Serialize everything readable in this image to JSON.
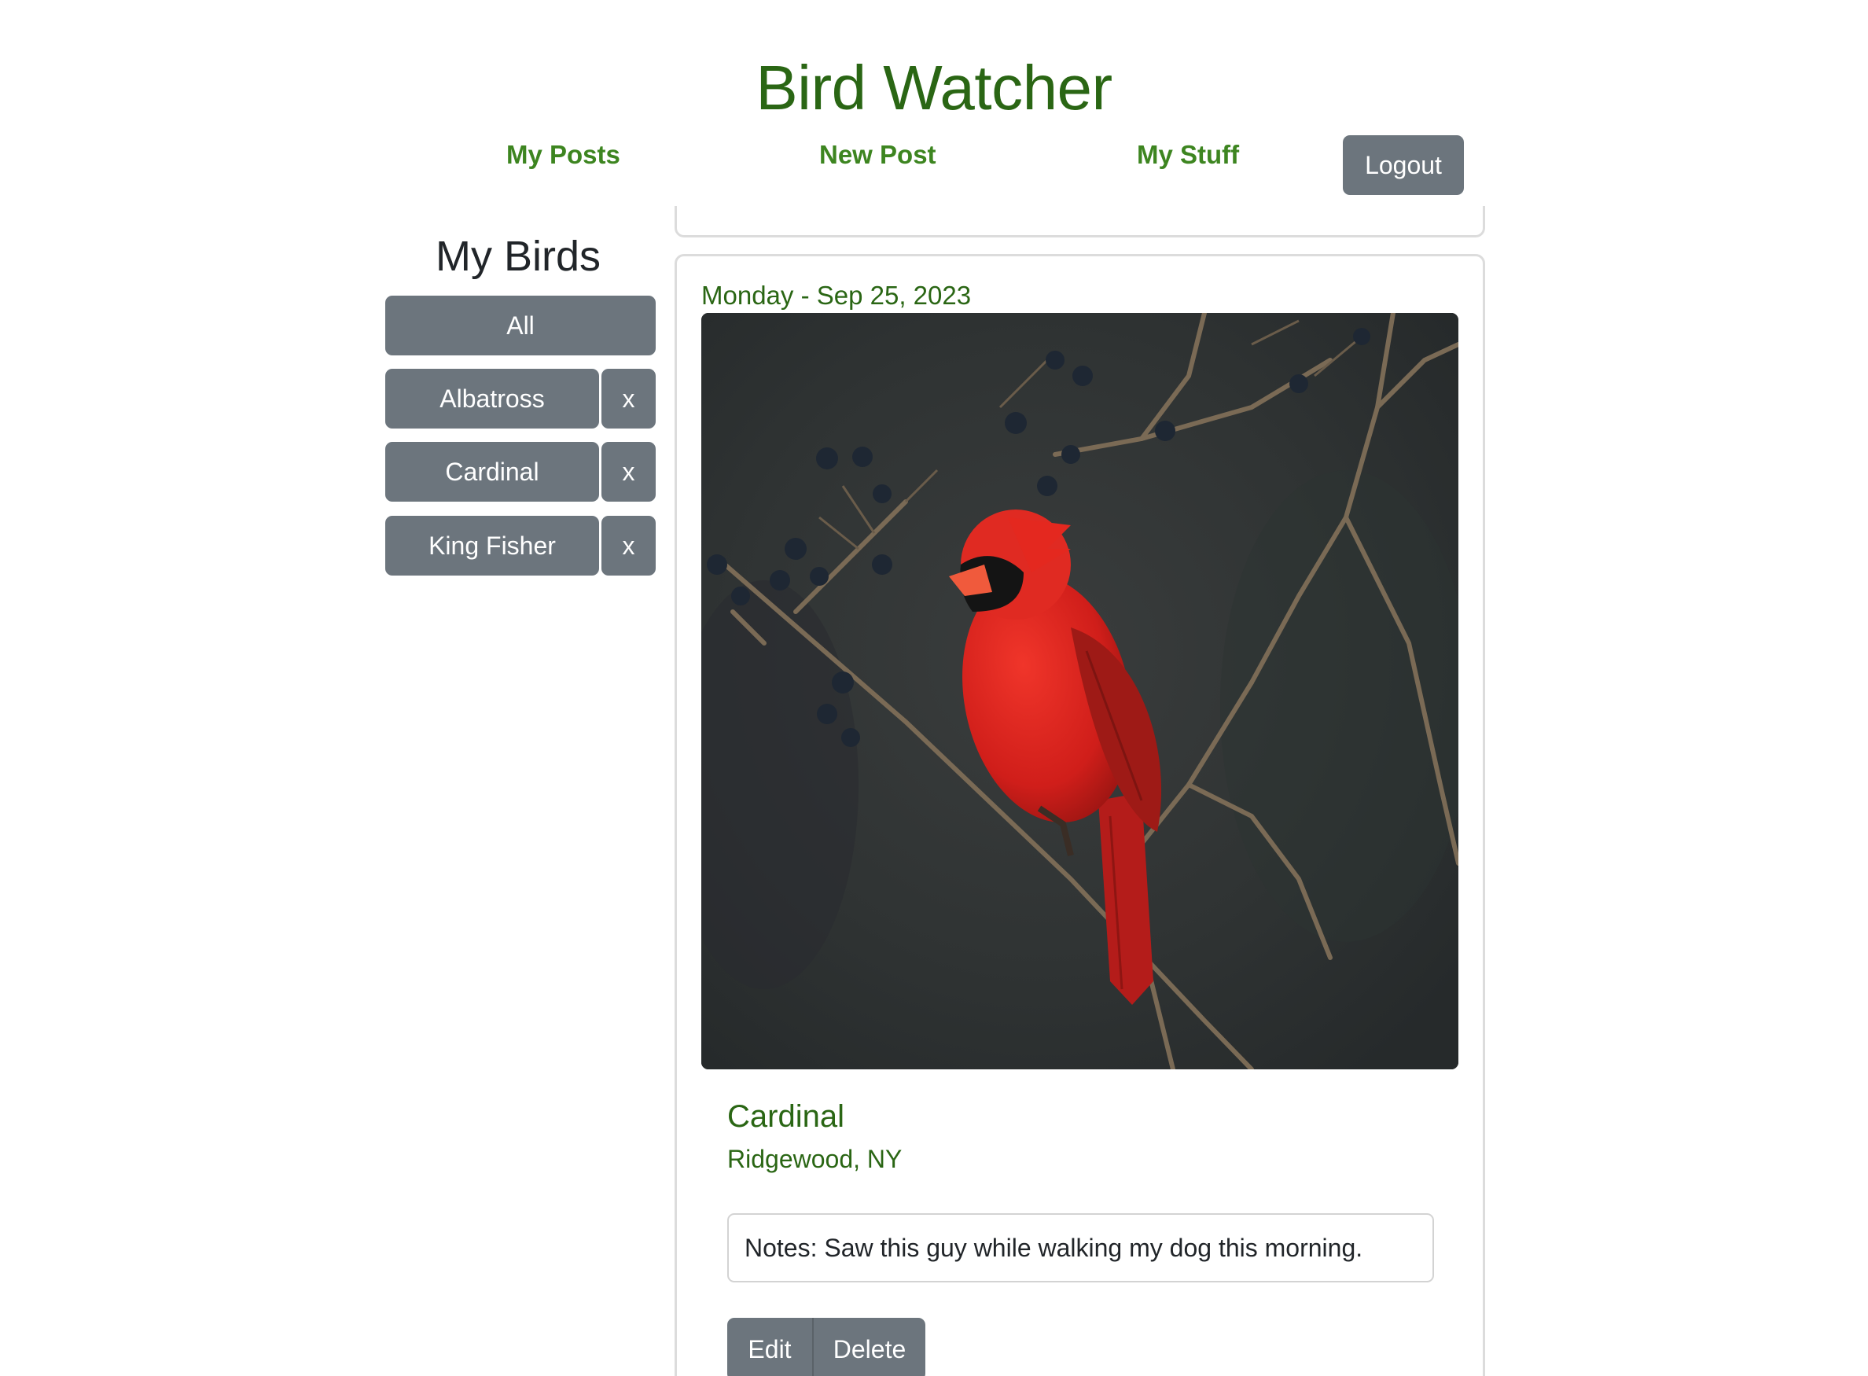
{
  "header": {
    "title": "Bird Watcher",
    "nav": {
      "my_posts": "My Posts",
      "new_post": "New Post",
      "my_stuff": "My Stuff"
    },
    "logout_label": "Logout"
  },
  "sidebar": {
    "title": "My Birds",
    "all_label": "All",
    "birds": [
      {
        "label": "Albatross",
        "remove": "x"
      },
      {
        "label": "Cardinal",
        "remove": "x"
      },
      {
        "label": "King Fisher",
        "remove": "x"
      }
    ]
  },
  "post": {
    "date": "Monday - Sep 25, 2023",
    "bird": "Cardinal",
    "location": "Ridgewood, NY",
    "notes": "Notes: Saw this guy while walking my dog this morning.",
    "edit_label": "Edit",
    "delete_label": "Delete"
  },
  "colors": {
    "brand_green": "#2a6614",
    "nav_green": "#3d8520",
    "button_gray": "#6c757d"
  }
}
